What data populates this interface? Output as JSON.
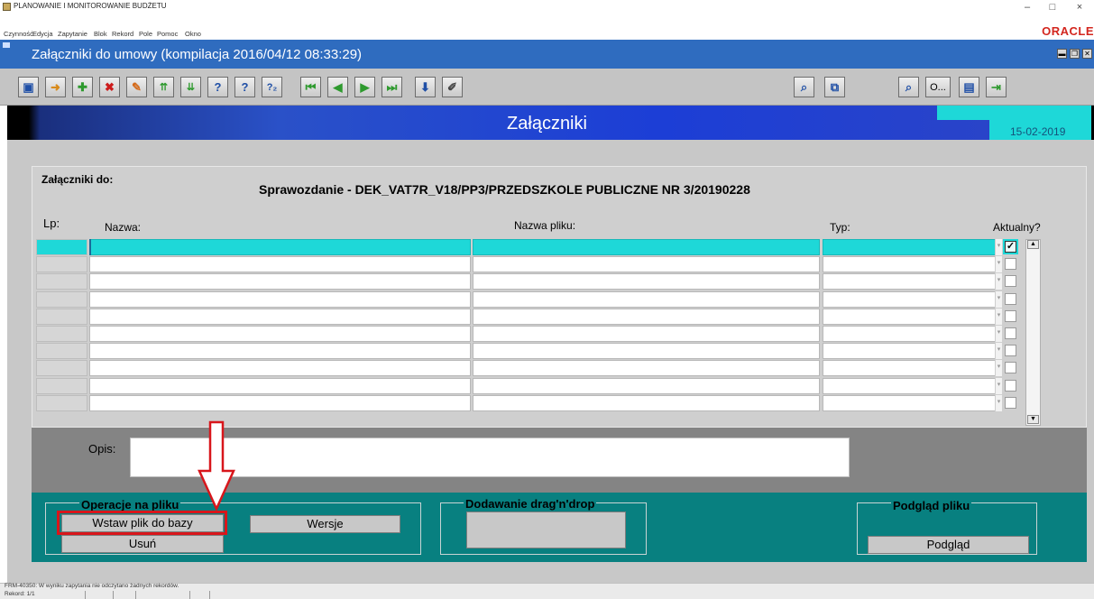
{
  "window": {
    "title": "PLANOWANIE I MONITOROWANIE BUDŻETU",
    "minimize": "–",
    "maximize": "□",
    "close": "×"
  },
  "menu": [
    "Czynność",
    "Edycja",
    "Zapytanie",
    "Blok",
    "Rekord",
    "Pole",
    "Pomoc",
    "Okno"
  ],
  "brand": "ORACLE",
  "form": {
    "title": "Załączniki do umowy (kompilacja 2016/04/12 08:33:29)"
  },
  "toolbar": {
    "query_label": "O..."
  },
  "header": {
    "title": "Załączniki",
    "date": "15-02-2019"
  },
  "attachments": {
    "for_label": "Załączniki do:",
    "context": "Sprawozdanie - DEK_VAT7R_V18/PP3/PRZEDSZKOLE PUBLICZNE NR 3/20190228",
    "columns": {
      "lp": "Lp:",
      "name": "Nazwa:",
      "file": "Nazwa pliku:",
      "type": "Typ:",
      "current": "Aktualny?"
    },
    "rows": [
      {
        "name": "",
        "file": "",
        "type": "",
        "current": true
      },
      {
        "name": "",
        "file": "",
        "type": "",
        "current": false
      },
      {
        "name": "",
        "file": "",
        "type": "",
        "current": false
      },
      {
        "name": "",
        "file": "",
        "type": "",
        "current": false
      },
      {
        "name": "",
        "file": "",
        "type": "",
        "current": false
      },
      {
        "name": "",
        "file": "",
        "type": "",
        "current": false
      },
      {
        "name": "",
        "file": "",
        "type": "",
        "current": false
      },
      {
        "name": "",
        "file": "",
        "type": "",
        "current": false
      },
      {
        "name": "",
        "file": "",
        "type": "",
        "current": false
      },
      {
        "name": "",
        "file": "",
        "type": "",
        "current": false
      }
    ]
  },
  "opis": {
    "label": "Opis:",
    "value": ""
  },
  "ops": {
    "file_ops_title": "Operacje na pliku",
    "insert_button": "Wstaw plik do bazy",
    "versions_button": "Wersje",
    "delete_button": "Usuń",
    "dragdrop_title": "Dodawanie drag'n'drop",
    "preview_title": "Podgląd pliku",
    "preview_button": "Podgląd"
  },
  "status": {
    "message": "FRM-40350: W wyniku zapytania nie odczytano żadnych rekordów.",
    "record": "Rekord: 1/1"
  },
  "colors": {
    "active_row": "#1ed8d8",
    "ops_band": "#088080",
    "highlight": "#d8161b",
    "form_title_bar": "#2f6cbf"
  }
}
